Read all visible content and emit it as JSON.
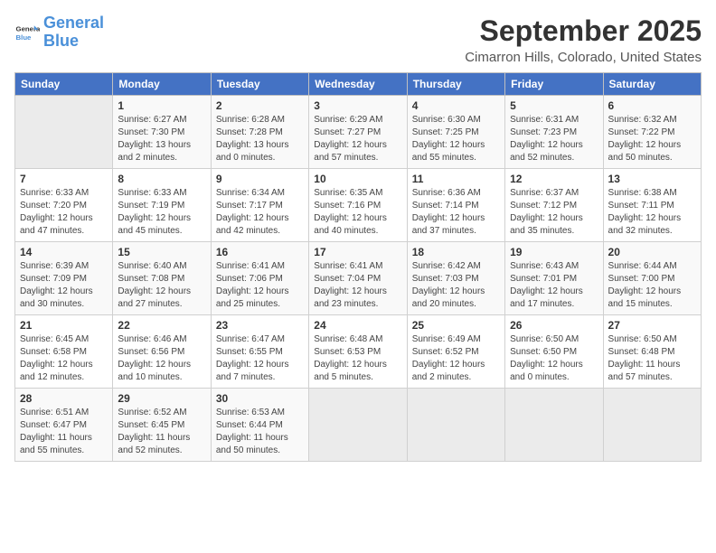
{
  "header": {
    "logo_line1": "General",
    "logo_line2": "Blue",
    "month_year": "September 2025",
    "location": "Cimarron Hills, Colorado, United States"
  },
  "days_of_week": [
    "Sunday",
    "Monday",
    "Tuesday",
    "Wednesday",
    "Thursday",
    "Friday",
    "Saturday"
  ],
  "weeks": [
    [
      {
        "day": "",
        "info": ""
      },
      {
        "day": "1",
        "info": "Sunrise: 6:27 AM\nSunset: 7:30 PM\nDaylight: 13 hours\nand 2 minutes."
      },
      {
        "day": "2",
        "info": "Sunrise: 6:28 AM\nSunset: 7:28 PM\nDaylight: 13 hours\nand 0 minutes."
      },
      {
        "day": "3",
        "info": "Sunrise: 6:29 AM\nSunset: 7:27 PM\nDaylight: 12 hours\nand 57 minutes."
      },
      {
        "day": "4",
        "info": "Sunrise: 6:30 AM\nSunset: 7:25 PM\nDaylight: 12 hours\nand 55 minutes."
      },
      {
        "day": "5",
        "info": "Sunrise: 6:31 AM\nSunset: 7:23 PM\nDaylight: 12 hours\nand 52 minutes."
      },
      {
        "day": "6",
        "info": "Sunrise: 6:32 AM\nSunset: 7:22 PM\nDaylight: 12 hours\nand 50 minutes."
      }
    ],
    [
      {
        "day": "7",
        "info": "Sunrise: 6:33 AM\nSunset: 7:20 PM\nDaylight: 12 hours\nand 47 minutes."
      },
      {
        "day": "8",
        "info": "Sunrise: 6:33 AM\nSunset: 7:19 PM\nDaylight: 12 hours\nand 45 minutes."
      },
      {
        "day": "9",
        "info": "Sunrise: 6:34 AM\nSunset: 7:17 PM\nDaylight: 12 hours\nand 42 minutes."
      },
      {
        "day": "10",
        "info": "Sunrise: 6:35 AM\nSunset: 7:16 PM\nDaylight: 12 hours\nand 40 minutes."
      },
      {
        "day": "11",
        "info": "Sunrise: 6:36 AM\nSunset: 7:14 PM\nDaylight: 12 hours\nand 37 minutes."
      },
      {
        "day": "12",
        "info": "Sunrise: 6:37 AM\nSunset: 7:12 PM\nDaylight: 12 hours\nand 35 minutes."
      },
      {
        "day": "13",
        "info": "Sunrise: 6:38 AM\nSunset: 7:11 PM\nDaylight: 12 hours\nand 32 minutes."
      }
    ],
    [
      {
        "day": "14",
        "info": "Sunrise: 6:39 AM\nSunset: 7:09 PM\nDaylight: 12 hours\nand 30 minutes."
      },
      {
        "day": "15",
        "info": "Sunrise: 6:40 AM\nSunset: 7:08 PM\nDaylight: 12 hours\nand 27 minutes."
      },
      {
        "day": "16",
        "info": "Sunrise: 6:41 AM\nSunset: 7:06 PM\nDaylight: 12 hours\nand 25 minutes."
      },
      {
        "day": "17",
        "info": "Sunrise: 6:41 AM\nSunset: 7:04 PM\nDaylight: 12 hours\nand 23 minutes."
      },
      {
        "day": "18",
        "info": "Sunrise: 6:42 AM\nSunset: 7:03 PM\nDaylight: 12 hours\nand 20 minutes."
      },
      {
        "day": "19",
        "info": "Sunrise: 6:43 AM\nSunset: 7:01 PM\nDaylight: 12 hours\nand 17 minutes."
      },
      {
        "day": "20",
        "info": "Sunrise: 6:44 AM\nSunset: 7:00 PM\nDaylight: 12 hours\nand 15 minutes."
      }
    ],
    [
      {
        "day": "21",
        "info": "Sunrise: 6:45 AM\nSunset: 6:58 PM\nDaylight: 12 hours\nand 12 minutes."
      },
      {
        "day": "22",
        "info": "Sunrise: 6:46 AM\nSunset: 6:56 PM\nDaylight: 12 hours\nand 10 minutes."
      },
      {
        "day": "23",
        "info": "Sunrise: 6:47 AM\nSunset: 6:55 PM\nDaylight: 12 hours\nand 7 minutes."
      },
      {
        "day": "24",
        "info": "Sunrise: 6:48 AM\nSunset: 6:53 PM\nDaylight: 12 hours\nand 5 minutes."
      },
      {
        "day": "25",
        "info": "Sunrise: 6:49 AM\nSunset: 6:52 PM\nDaylight: 12 hours\nand 2 minutes."
      },
      {
        "day": "26",
        "info": "Sunrise: 6:50 AM\nSunset: 6:50 PM\nDaylight: 12 hours\nand 0 minutes."
      },
      {
        "day": "27",
        "info": "Sunrise: 6:50 AM\nSunset: 6:48 PM\nDaylight: 11 hours\nand 57 minutes."
      }
    ],
    [
      {
        "day": "28",
        "info": "Sunrise: 6:51 AM\nSunset: 6:47 PM\nDaylight: 11 hours\nand 55 minutes."
      },
      {
        "day": "29",
        "info": "Sunrise: 6:52 AM\nSunset: 6:45 PM\nDaylight: 11 hours\nand 52 minutes."
      },
      {
        "day": "30",
        "info": "Sunrise: 6:53 AM\nSunset: 6:44 PM\nDaylight: 11 hours\nand 50 minutes."
      },
      {
        "day": "",
        "info": ""
      },
      {
        "day": "",
        "info": ""
      },
      {
        "day": "",
        "info": ""
      },
      {
        "day": "",
        "info": ""
      }
    ]
  ]
}
